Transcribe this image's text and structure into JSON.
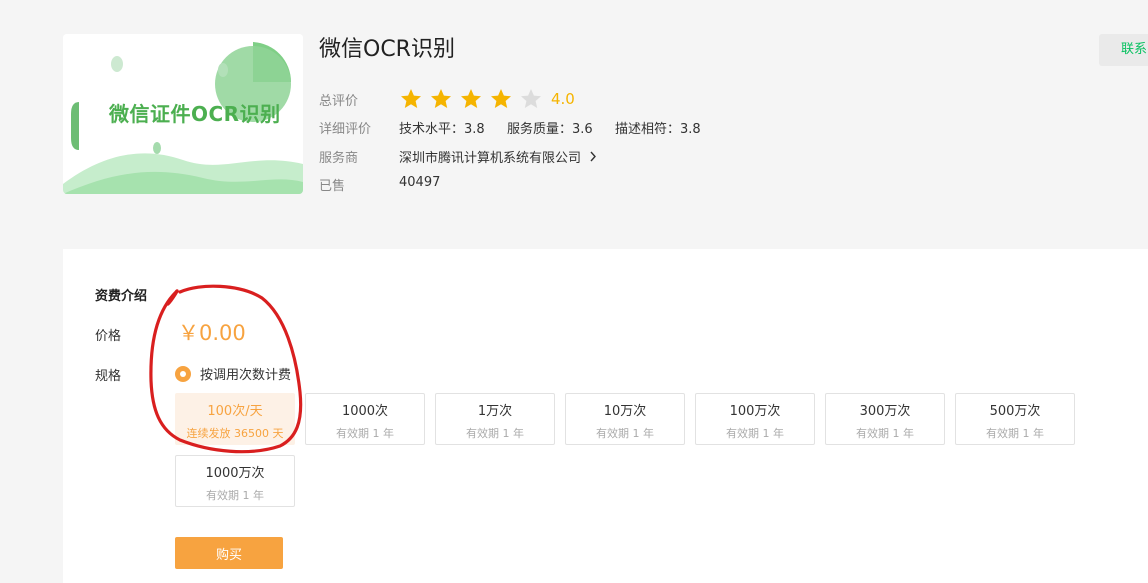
{
  "product": {
    "image_caption": "微信证件OCR识别",
    "title": "微信OCR识别",
    "contact_label": "联系",
    "overall_label": "总评价",
    "rating": "4.0",
    "rating_stars": 4,
    "rating_max": 5,
    "detail_label": "详细评价",
    "detail": {
      "tech": "技术水平：3.8",
      "service": "服务质量：3.6",
      "desc": "描述相符：3.8"
    },
    "provider_label": "服务商",
    "provider": "深圳市腾讯计算机系统有限公司",
    "sold_label": "已售",
    "sold": "40497"
  },
  "pricing": {
    "section_title": "资费介绍",
    "price_label": "价格",
    "price": "￥0.00",
    "spec_label": "规格",
    "billing_mode": "按调用次数计费",
    "options": [
      {
        "title": "100次/天",
        "sub": "连续发放 36500 天",
        "selected": true
      },
      {
        "title": "1000次",
        "sub": "有效期 1 年"
      },
      {
        "title": "1万次",
        "sub": "有效期 1 年"
      },
      {
        "title": "10万次",
        "sub": "有效期 1 年"
      },
      {
        "title": "100万次",
        "sub": "有效期 1 年"
      },
      {
        "title": "300万次",
        "sub": "有效期 1 年"
      },
      {
        "title": "500万次",
        "sub": "有效期 1 年"
      },
      {
        "title": "1000万次",
        "sub": "有效期 1 年"
      }
    ],
    "buy_label": "购买"
  },
  "colors": {
    "accent": "#f7a340",
    "star": "#f5b400",
    "brand_green": "#07c160",
    "annotation": "#d91f1f"
  }
}
